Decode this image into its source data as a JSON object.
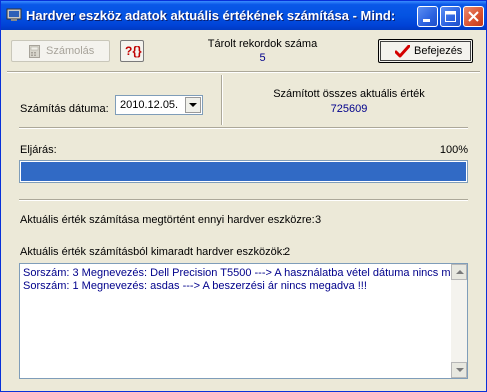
{
  "window": {
    "title": "Hardver eszköz adatok aktuális értékének számítása - Mind:"
  },
  "toolbar": {
    "calculate_label": "Számolás",
    "sql_button_label": "?{}",
    "end_label": "Befejezés"
  },
  "stored": {
    "label": "Tárolt rekordok száma",
    "value": "5"
  },
  "date": {
    "label": "Számítás dátuma:",
    "value": "2010.12.05."
  },
  "total": {
    "label": "Számított összes aktuális érték",
    "value": "725609"
  },
  "procedure": {
    "label": "Eljárás:",
    "percent_text": "100%",
    "progress": 1.0
  },
  "done": {
    "label": "Aktuális érték számítása megtörtént ennyi hardver eszközre:",
    "count": "3"
  },
  "skipped": {
    "label": "Aktuális érték számításból kimaradt hardver eszközök:",
    "count": "2",
    "items": [
      "Sorszám: 3   Megnevezés: Dell Precision T5500   --->   A használatba vétel dátuma nincs m",
      "Sorszám: 1   Megnevezés: asdas   --->   A beszerzési ár nincs megadva !!!"
    ]
  },
  "colors": {
    "title_bar": "#0453E2",
    "progress_fill": "#316AC5",
    "value_text": "#00008B",
    "end_check": "#D40000"
  },
  "icons": [
    "app-icon",
    "calculator-icon",
    "sql-icon",
    "checkmark-icon",
    "minimize-icon",
    "maximize-icon",
    "close-icon"
  ]
}
